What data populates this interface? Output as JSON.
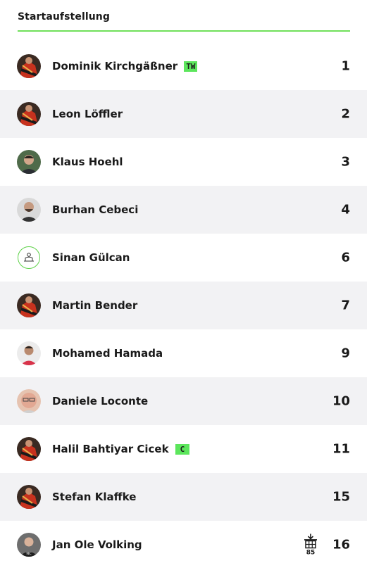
{
  "header": {
    "title": "Startaufstellung"
  },
  "accent_color": "#5ce65c",
  "players": [
    {
      "name": "Dominik Kirchgäßner",
      "number": "1",
      "badge": "TW",
      "avatar": "jersey-red"
    },
    {
      "name": "Leon Löffler",
      "number": "2",
      "avatar": "jersey-red"
    },
    {
      "name": "Klaus Hoehl",
      "number": "3",
      "avatar": "photo-green"
    },
    {
      "name": "Burhan Cebeci",
      "number": "4",
      "avatar": "photo-grey"
    },
    {
      "name": "Sinan Gülcan",
      "number": "6",
      "avatar": "placeholder-icon"
    },
    {
      "name": "Martin Bender",
      "number": "7",
      "avatar": "jersey-red"
    },
    {
      "name": "Mohamed Hamada",
      "number": "9",
      "avatar": "photo-light"
    },
    {
      "name": "Daniele Loconte",
      "number": "10",
      "avatar": "photo-face"
    },
    {
      "name": "Halil Bahtiyar Cicek",
      "number": "11",
      "badge": "C",
      "avatar": "jersey-red"
    },
    {
      "name": "Stefan Klaffke",
      "number": "15",
      "avatar": "jersey-red"
    },
    {
      "name": "Jan Ole Volking",
      "number": "16",
      "avatar": "photo-dark",
      "substitution": {
        "icon": "substitution-out-icon",
        "minute": "85"
      }
    }
  ]
}
